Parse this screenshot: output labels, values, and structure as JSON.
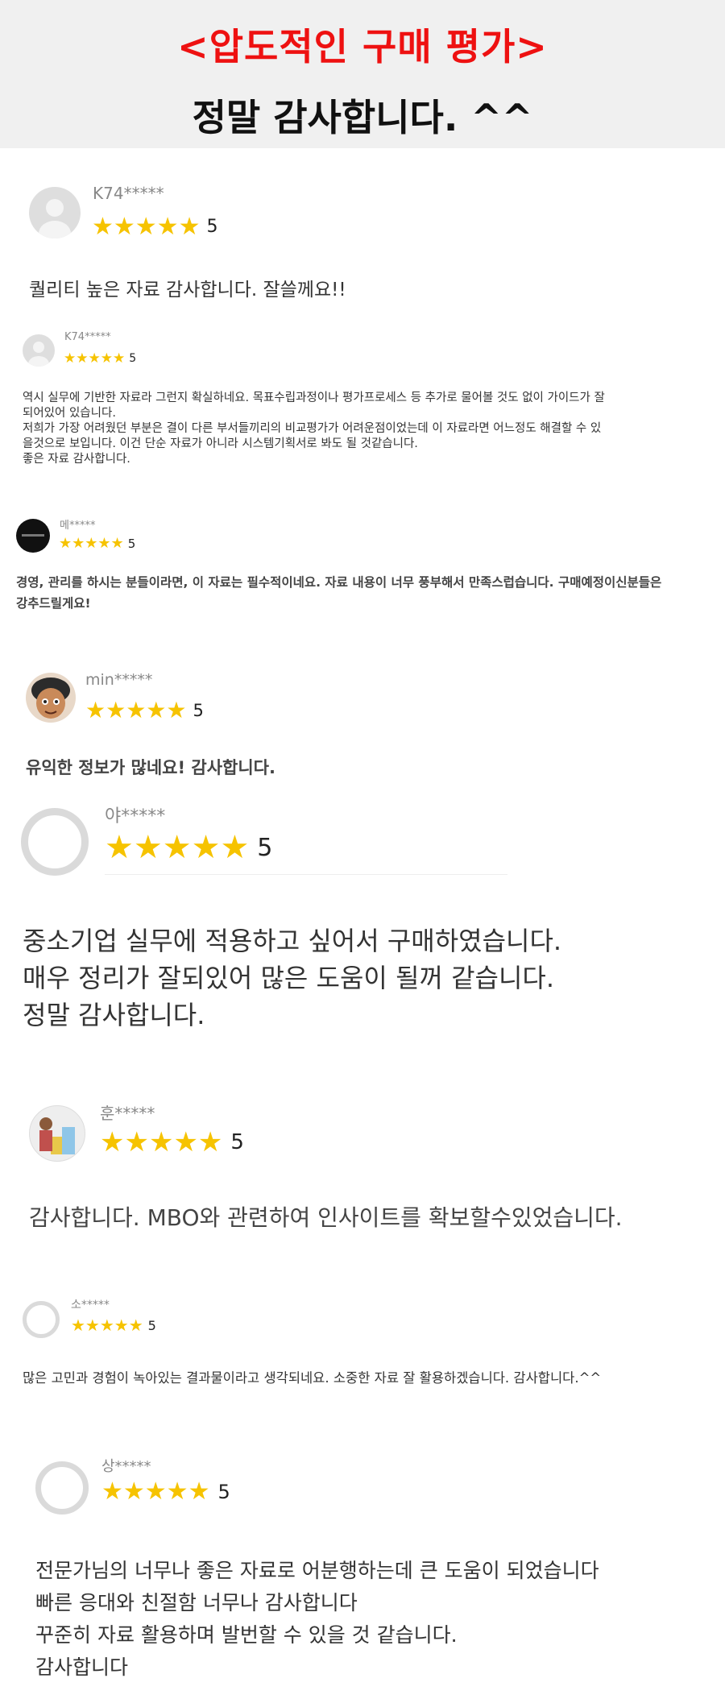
{
  "header": {
    "title": "<압도적인 구매 평가>",
    "subtitle": "정말 감사합니다. ^^"
  },
  "star_glyph": "★★★★★",
  "colors": {
    "title": "#ee1111",
    "star": "#f6c300",
    "header_bg": "#f0f0f0"
  },
  "reviews": [
    {
      "user": "K74*****",
      "stars": 5,
      "rating": "5",
      "avatar": "gray-person-icon",
      "text": "퀄리티 높은 자료 감사합니다. 잘쓸께요!!"
    },
    {
      "user": "K74*****",
      "stars": 5,
      "rating": "5",
      "avatar": "gray-person-icon",
      "text": "역시 실무에 기반한 자료라 그런지 확실하네요. 목표수립과정이나 평가프로세스 등 추가로 물어볼 것도 없이 가이드가 잘\n되어있어 있습니다.\n저희가 가장 어려웠던 부분은 결이 다른 부서들끼리의 비교평가가 어려운점이었는데 이 자료라면 어느정도 해결할 수 있\n을것으로 보입니다. 이건 단순 자료가 아니라 시스템기획서로 봐도 될 것같습니다.\n좋은 자료 감사합니다."
    },
    {
      "user": "메*****",
      "stars": 5,
      "rating": "5",
      "avatar": "black-logo-avatar",
      "text": "경영, 관리를 하시는 분들이라면, 이 자료는 필수적이네요. 자료 내용이 너무 풍부해서 만족스럽습니다. 구매예정이신분들은\n강추드릴게요!"
    },
    {
      "user": "min*****",
      "stars": 5,
      "rating": "5",
      "avatar": "emoji-face-avatar",
      "text": "유익한 정보가 많네요! 감사합니다."
    },
    {
      "user": "야*****",
      "stars": 5,
      "rating": "5",
      "avatar": "ring-avatar",
      "text": "중소기업 실무에 적용하고 싶어서 구매하였습니다.\n매우 정리가 잘되있어 많은 도움이 될꺼 같습니다.\n정말 감사합니다."
    },
    {
      "user": "훈*****",
      "stars": 5,
      "rating": "5",
      "avatar": "illustration-avatar",
      "text": "감사합니다. MBO와 관련하여 인사이트를 확보할수있었습니다."
    },
    {
      "user": "소*****",
      "stars": 5,
      "rating": "5",
      "avatar": "ring-avatar",
      "text": "많은 고민과 경험이 녹아있는 결과물이라고 생각되네요. 소중한 자료 잘 활용하겠습니다. 감사합니다.^^"
    },
    {
      "user": "상*****",
      "stars": 5,
      "rating": "5",
      "avatar": "ring-avatar",
      "text": "전문가님의 너무나 좋은 자료로 어분행하는데 큰 도움이 되었습니다\n빠른 응대와 친절함 너무나 감사합니다\n꾸준히 자료 활용하며 발번할 수 있을 것 같습니다.\n감사합니다"
    }
  ]
}
